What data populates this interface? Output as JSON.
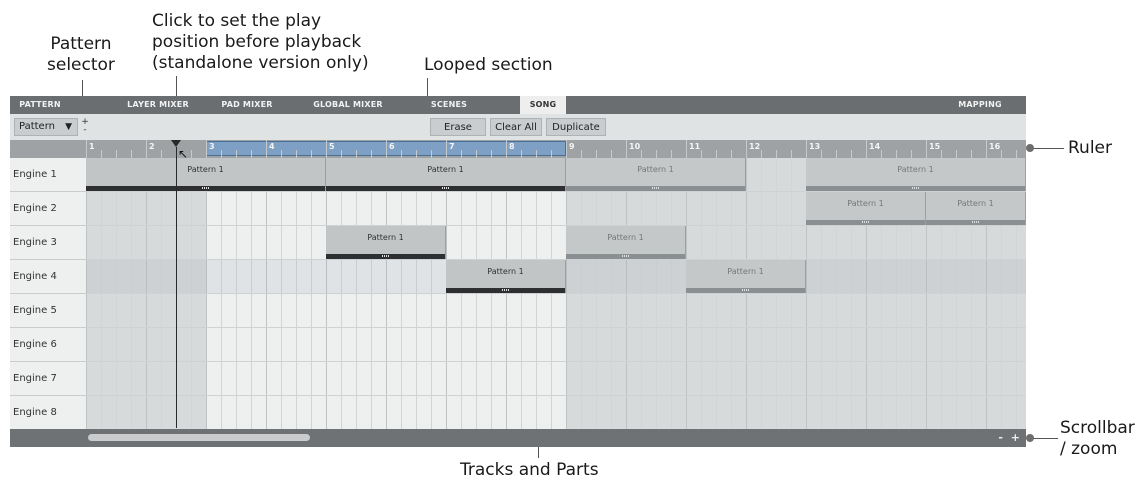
{
  "annotations": {
    "pattern_selector": "Pattern\nselector",
    "play_position": "Click to set the play\nposition before playback\n(standalone version only)",
    "looped_section": "Looped section",
    "ruler": "Ruler",
    "scrollbar_zoom": "Scrollbar\n/ zoom",
    "tracks_parts": "Tracks and Parts"
  },
  "tabs": [
    {
      "label": "PATTERN",
      "active": false
    },
    {
      "label": "LAYER MIXER",
      "active": false
    },
    {
      "label": "PAD MIXER",
      "active": false
    },
    {
      "label": "GLOBAL MIXER",
      "active": false
    },
    {
      "label": "SCENES",
      "active": false
    },
    {
      "label": "SONG",
      "active": true
    },
    {
      "label": "MAPPING",
      "active": false
    }
  ],
  "toolbar": {
    "pattern_select_value": "Pattern",
    "pattern_select_arrow": "▼",
    "plus": "+",
    "minus": "-",
    "erase_label": "Erase",
    "clear_all_label": "Clear All",
    "duplicate_label": "Duplicate"
  },
  "ruler": {
    "bars": [
      "1",
      "2",
      "3",
      "4",
      "5",
      "6",
      "7",
      "8",
      "9",
      "10",
      "11",
      "12",
      "13",
      "14",
      "15",
      "16"
    ],
    "loop_start_bar": 3,
    "loop_end_bar": 9
  },
  "tracks": [
    {
      "name": "Engine 1",
      "parts": [
        {
          "label": "Pattern 1",
          "start": 1,
          "end": 5,
          "style": "solid"
        },
        {
          "label": "Pattern 1",
          "start": 5,
          "end": 9,
          "style": "solid"
        },
        {
          "label": "Pattern 1",
          "start": 9,
          "end": 12,
          "style": "faded"
        },
        {
          "label": "Pattern 1",
          "start": 13,
          "end": 17,
          "style": "faded"
        }
      ]
    },
    {
      "name": "Engine 2",
      "parts": [
        {
          "label": "Pattern 1",
          "start": 13,
          "end": 15,
          "style": "faded"
        },
        {
          "label": "Pattern 1",
          "start": 15,
          "end": 17,
          "style": "faded"
        }
      ]
    },
    {
      "name": "Engine 3",
      "parts": [
        {
          "label": "Pattern 1",
          "start": 5,
          "end": 7,
          "style": "solid"
        },
        {
          "label": "Pattern 1",
          "start": 9,
          "end": 11,
          "style": "faded"
        }
      ]
    },
    {
      "name": "Engine 4",
      "parts": [
        {
          "label": "Pattern 1",
          "start": 7,
          "end": 9,
          "style": "solid"
        },
        {
          "label": "Pattern 1",
          "start": 11,
          "end": 13,
          "style": "faded"
        }
      ]
    },
    {
      "name": "Engine 5",
      "parts": []
    },
    {
      "name": "Engine 6",
      "parts": []
    },
    {
      "name": "Engine 7",
      "parts": []
    },
    {
      "name": "Engine 8",
      "parts": []
    }
  ],
  "playhead_bar": 2.5,
  "zoom_controls": "- +",
  "colors": {
    "tab_bar": "#6a6e71",
    "loop_region": "#7ea0c4",
    "part_solid": "#c2c5c6",
    "part_faded": "#c5c8c9",
    "part_footer": "#2d2f31"
  }
}
